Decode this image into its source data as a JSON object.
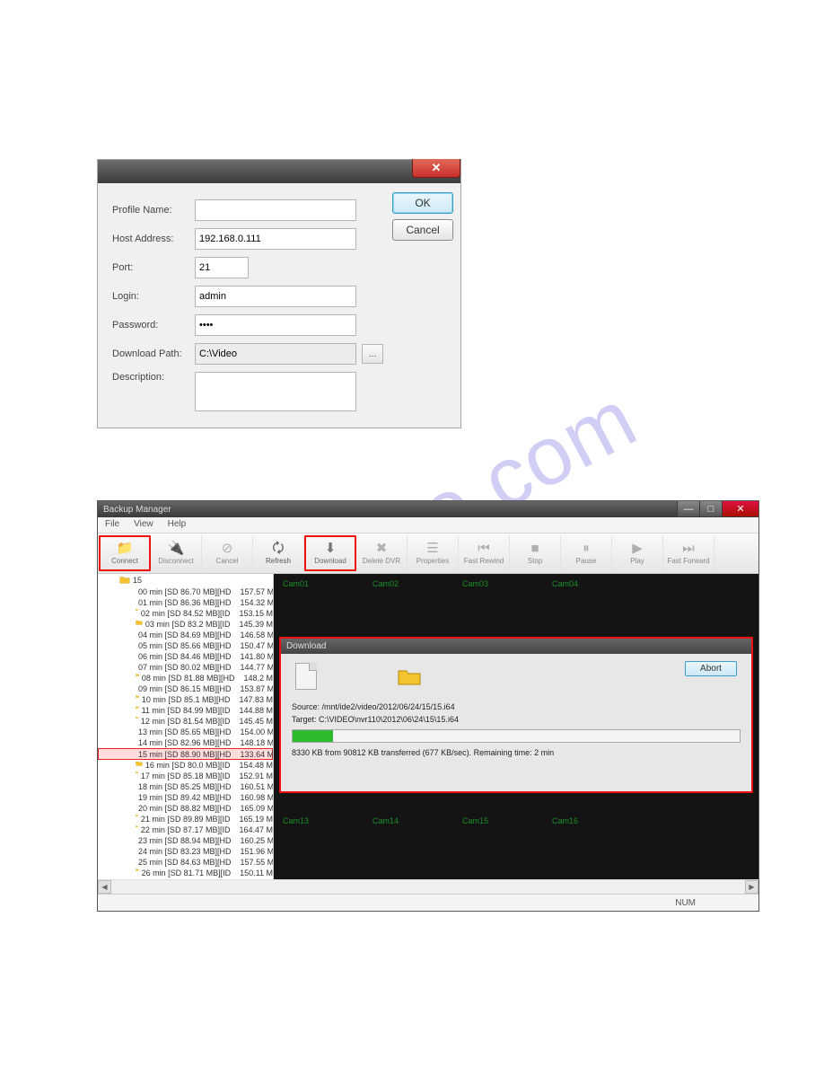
{
  "watermark": "ualshive.com",
  "dialog1": {
    "labels": {
      "profile_name": "Profile Name:",
      "host_address": "Host Address:",
      "port": "Port:",
      "login": "Login:",
      "password": "Password:",
      "download_path": "Download Path:",
      "description": "Description:"
    },
    "values": {
      "profile_name": "",
      "host_address": "192.168.0.111",
      "port": "21",
      "login": "admin",
      "password": "••••",
      "download_path": "C:\\Video",
      "description": ""
    },
    "browse_label": "...",
    "ok_label": "OK",
    "cancel_label": "Cancel",
    "close_glyph": "✕"
  },
  "app": {
    "title": "Backup Manager",
    "menu": [
      "File",
      "View",
      "Help"
    ],
    "window_buttons": {
      "min": "—",
      "max": "□",
      "close": "✕"
    },
    "toolbar": [
      {
        "label": "Connect",
        "highlight": true
      },
      {
        "label": "Disconnect",
        "highlight": false
      },
      {
        "label": "Cancel",
        "highlight": false
      },
      {
        "label": "Refresh",
        "highlight": false,
        "enabled": true
      },
      {
        "label": "Download",
        "highlight": true
      },
      {
        "label": "Delete DVR",
        "highlight": false
      },
      {
        "label": "Properties",
        "highlight": false
      },
      {
        "label": "Fast Rewind",
        "highlight": false
      },
      {
        "label": "Stop",
        "highlight": false
      },
      {
        "label": "Pause",
        "highlight": false
      },
      {
        "label": "Play",
        "highlight": false
      },
      {
        "label": "Fast Forward",
        "highlight": false
      }
    ],
    "status": "NUM",
    "tree": {
      "root": "15",
      "items": [
        {
          "name": "00 min [SD   86.70 MB][HD",
          "size": "157.57 M",
          "sel": false
        },
        {
          "name": "01 min [SD   86.36 MB][HD",
          "size": "154.32 M",
          "sel": false
        },
        {
          "name": "02 min [SD   84.52 MB][ID",
          "size": "153.15 M",
          "sel": false
        },
        {
          "name": "03 min [SD   83.2  MB][ID",
          "size": "145.39 M",
          "sel": false
        },
        {
          "name": "04 min [SD   84.69 MB][HD",
          "size": "146.58 M",
          "sel": false
        },
        {
          "name": "05 min [SD   85.66 MB][HD",
          "size": "150.47 M",
          "sel": false
        },
        {
          "name": "06 min [SD   84.46 MB][HD",
          "size": "141.80 M",
          "sel": false
        },
        {
          "name": "07 min [SD   80.02 MB][HD",
          "size": "144.77 M",
          "sel": false
        },
        {
          "name": "08 min [SD   81.88 MB][HD",
          "size": "148.2  M",
          "sel": false
        },
        {
          "name": "09 min [SD   86.15 MB][HD",
          "size": "153.87 M",
          "sel": false
        },
        {
          "name": "10 min [SD   85.1  MB][HD",
          "size": "147.83 M",
          "sel": false
        },
        {
          "name": "11 min [SD   84.99 MB][ID",
          "size": "144.88 M",
          "sel": false
        },
        {
          "name": "12 min [SD   81.54 MB][ID",
          "size": "145.45 M",
          "sel": false
        },
        {
          "name": "13 min [SD   85.65 MB][HD",
          "size": "154.00 M",
          "sel": false
        },
        {
          "name": "14 min [SD   82.96 MB][HD",
          "size": "148.18 M",
          "sel": false
        },
        {
          "name": "15 min [SD   88.90 MB][HD",
          "size": "133.64 M",
          "sel": true
        },
        {
          "name": "16 min [SD   80.0  MB][ID",
          "size": "154.48 M",
          "sel": false
        },
        {
          "name": "17 min [SD   85.18 MB][ID",
          "size": "152.91 M",
          "sel": false
        },
        {
          "name": "18 min [SD   85.25 MB][HD",
          "size": "160.51 M",
          "sel": false
        },
        {
          "name": "19 min [SD   89.42 MB][HD",
          "size": "160.98 M",
          "sel": false
        },
        {
          "name": "20 min [SD   88.82 MB][HD",
          "size": "165.09 M",
          "sel": false
        },
        {
          "name": "21 min [SD   89.89 MB][ID",
          "size": "165.19 M",
          "sel": false
        },
        {
          "name": "22 min [SD   87.17 MB][ID",
          "size": "164.47 M",
          "sel": false
        },
        {
          "name": "23 min [SD   88.94 MB][HD",
          "size": "160.25 M",
          "sel": false
        },
        {
          "name": "24 min [SD   83.23 MB][HD",
          "size": "151.96 M",
          "sel": false
        },
        {
          "name": "25 min [SD   84.63 MB][HD",
          "size": "157.55 M",
          "sel": false
        },
        {
          "name": "26 min [SD   81.71 MB][ID",
          "size": "150.11 M",
          "sel": false
        }
      ]
    },
    "cams": {
      "c1": "Cam01",
      "c2": "Cam02",
      "c3": "Cam03",
      "c4": "Cam04",
      "c13": "Cam13",
      "c14": "Cam14",
      "c15": "Cam15",
      "c16": "Cam16"
    },
    "download": {
      "title": "Download",
      "abort": "Abort",
      "source": "Source: /mnt/ide2/video/2012/06/24/15/15.i64",
      "target": "Target: C:\\VIDEO\\nvr110\\2012\\06\\24\\15\\15.i64",
      "progress_pct": 9,
      "status": "8330 KB from 90812 KB transferred (677 KB/sec). Remaining time: 2 min"
    }
  }
}
